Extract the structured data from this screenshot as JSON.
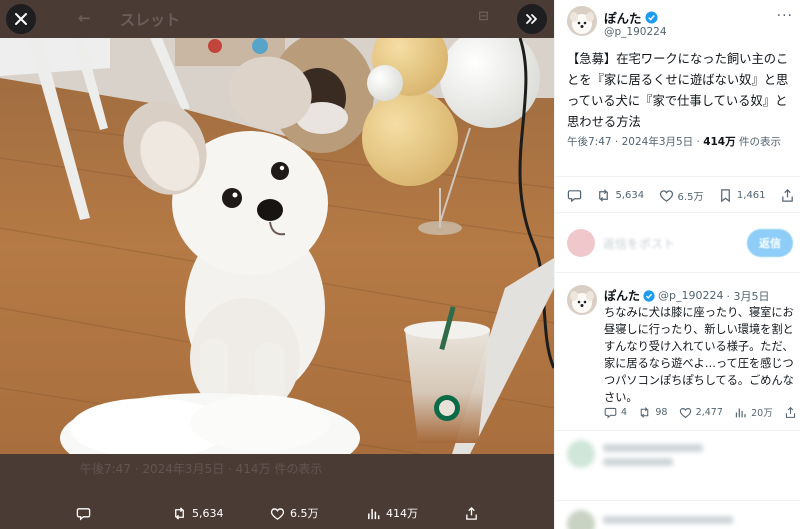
{
  "viewer": {
    "close_icon": "close-icon",
    "back_title": "スレット",
    "expand_icon": "double-chevron-right-icon",
    "ghost_caption": "午後7:47 · 2024年3月5日 · 414万 件の表示",
    "actions": {
      "reply_icon": "reply-icon",
      "retweets": "5,634",
      "likes": "6.5万",
      "views": "414万",
      "share_icon": "share-icon"
    }
  },
  "tweet": {
    "display_name": "ぽんた",
    "handle": "@p_190224",
    "more_label": "···",
    "text": "【急募】在宅ワークになった飼い主のことを『家に居るくせに遊ばない奴』と思っている犬に『家で仕事している奴』と思わせる方法",
    "time": "午後7:47 · 2024年3月5日 · ",
    "views_count": "414万",
    "views_label": " 件の表示",
    "stats": {
      "retweets": "5,634",
      "likes": "6.5万",
      "bookmarks": "1,461"
    }
  },
  "reply_box": {
    "placeholder": "返信をポスト",
    "button": "返信"
  },
  "reply": {
    "display_name": "ぽんた",
    "handle": "@p_190224",
    "date": "· 3月5日",
    "more_label": "···",
    "text": "ちなみに犬は膝に座ったり、寝室にお昼寝しに行ったり、新しい環境を割とすんなり受け入れている様子。ただ、家に居るなら遊べよ…って圧を感じつつパソコンぽちぽちしてる。ごめんなさい。",
    "stats": {
      "replies": "4",
      "retweets": "98",
      "likes": "2,477",
      "views": "20万"
    }
  },
  "colors": {
    "viewer_bg": "#4b3b35",
    "accent": "#1d9bf0",
    "muted_text": "#536471"
  }
}
